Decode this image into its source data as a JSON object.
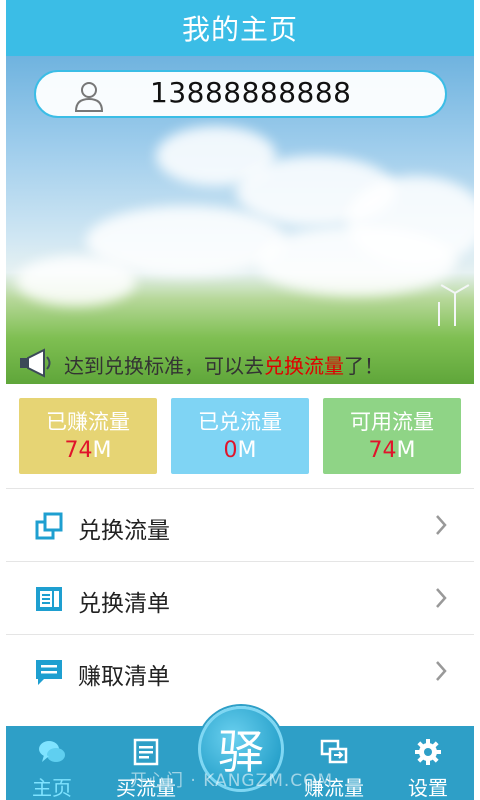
{
  "header": {
    "title": "我的主页"
  },
  "account": {
    "phone": "13888888888"
  },
  "notice": {
    "text_part1": "达到兑换标准，可以去",
    "text_highlight": "兑换流量",
    "text_part2": "了！"
  },
  "stats": [
    {
      "label": "已赚流量",
      "value": "74",
      "unit": "M"
    },
    {
      "label": "已兑流量",
      "value": "0",
      "unit": "M"
    },
    {
      "label": "可用流量",
      "value": "74",
      "unit": "M"
    }
  ],
  "menu": [
    {
      "label": "兑换流量",
      "icon": "exchange-icon"
    },
    {
      "label": "兑换清单",
      "icon": "list-icon"
    },
    {
      "label": "赚取清单",
      "icon": "chat-list-icon"
    }
  ],
  "nav": [
    {
      "label": "主页",
      "icon": "chat-bubbles-icon"
    },
    {
      "label": "买流量",
      "icon": "document-icon"
    },
    {
      "label": "赚流量",
      "icon": "screens-icon"
    },
    {
      "label": "设置",
      "icon": "gear-icon"
    }
  ],
  "center_button": {
    "char": "驿"
  },
  "watermark": "开心门 · KANGZM.COM",
  "colors": {
    "accent": "#3bbde6",
    "nav": "#2e9fc7",
    "highlight": "#e00000"
  }
}
